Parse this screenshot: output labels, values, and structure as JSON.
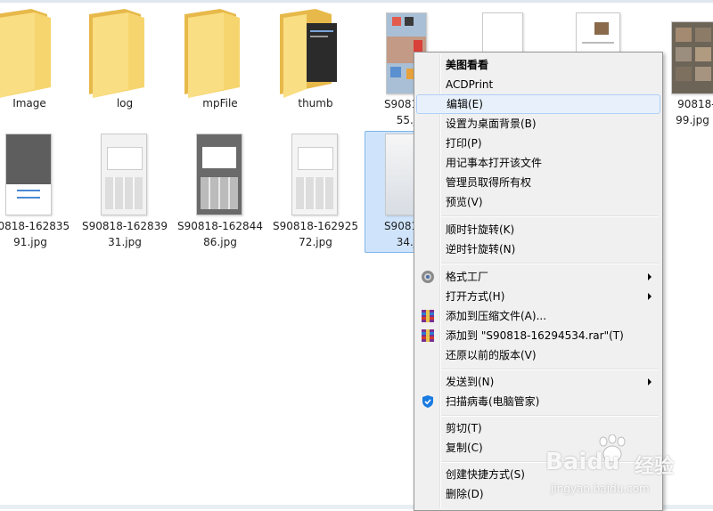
{
  "folders": [
    {
      "name": "Image"
    },
    {
      "name": "log"
    },
    {
      "name": "mpFile"
    },
    {
      "name": "thumb"
    }
  ],
  "files_row1": [
    {
      "line1": "S90818-",
      "line2": "55.j"
    },
    {
      "line1": "",
      "line2": ""
    },
    {
      "line1": "",
      "line2": ""
    },
    {
      "line1": "90818-16",
      "line2": "99.jpg"
    }
  ],
  "files_row2": [
    {
      "line1": "90818-162835",
      "line2": "91.jpg"
    },
    {
      "line1": "S90818-162839",
      "line2": "31.jpg"
    },
    {
      "line1": "S90818-162844",
      "line2": "86.jpg"
    },
    {
      "line1": "S90818-162925",
      "line2": "72.jpg"
    },
    {
      "line1": "S90818-",
      "line2": "34.j"
    }
  ],
  "context_menu": {
    "items": [
      {
        "label": "美图看看",
        "bold": true
      },
      {
        "label": "ACDPrint"
      },
      {
        "label": "编辑(E)",
        "hover": true
      },
      {
        "label": "设置为桌面背景(B)"
      },
      {
        "label": "打印(P)"
      },
      {
        "label": "用记事本打开该文件"
      },
      {
        "label": "管理员取得所有权"
      },
      {
        "label": "预览(V)"
      },
      {
        "label": "顺时针旋转(K)"
      },
      {
        "label": "逆时针旋转(N)"
      },
      {
        "label": "格式工厂",
        "icon": "format-factory-icon",
        "submenu": true
      },
      {
        "label": "打开方式(H)",
        "submenu": true
      },
      {
        "label": "添加到压缩文件(A)...",
        "icon": "winrar-icon"
      },
      {
        "label": "添加到 \"S90818-16294534.rar\"(T)",
        "icon": "winrar-icon"
      },
      {
        "label": "还原以前的版本(V)"
      },
      {
        "label": "发送到(N)",
        "submenu": true
      },
      {
        "label": "扫描病毒(电脑管家)",
        "icon": "shield-icon"
      },
      {
        "label": "剪切(T)"
      },
      {
        "label": "复制(C)"
      },
      {
        "label": "创建快捷方式(S)"
      },
      {
        "label": "删除(D)"
      }
    ]
  },
  "watermark": {
    "logo": "Baidu",
    "text": "经验",
    "url": "jingyan.baidu.com"
  },
  "colors": {
    "selection": "#cfe4fb",
    "menu_bg": "#f0f0f0",
    "hover": "#e8f1fb",
    "folder": "#f4cd62"
  }
}
